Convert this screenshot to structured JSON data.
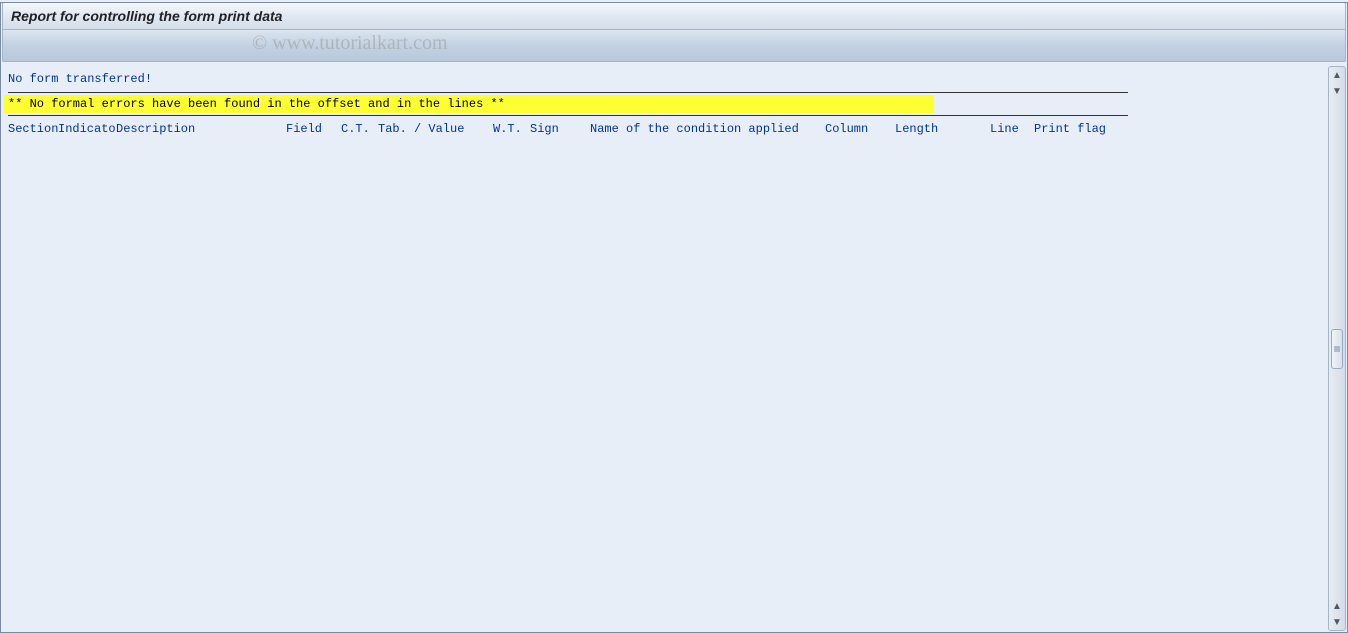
{
  "header": {
    "title": "Report for controlling the form print data"
  },
  "watermark": "© www.tutorialkart.com",
  "report": {
    "status": "No form transferred!",
    "message": "** No formal errors have been found in the offset and in the lines **",
    "columns": {
      "section": "Section",
      "indicato": "Indicato",
      "description": "Description",
      "field": "Field",
      "ct": "C.T.",
      "tab_value": "Tab. / Value",
      "wt": "W.T.",
      "sign": "Sign",
      "condition_name": "Name of the condition applied",
      "column": "Column",
      "length": "Length",
      "line": "Line",
      "print_flag": "Print flag"
    }
  }
}
